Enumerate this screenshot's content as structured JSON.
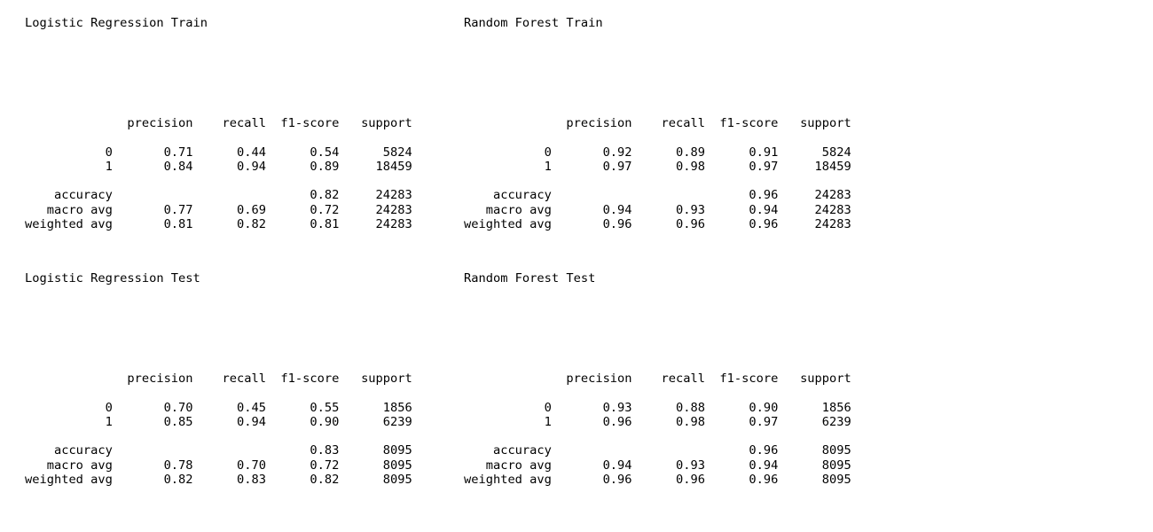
{
  "reports": [
    {
      "title": "Logistic Regression Train",
      "text": "\n\n\n\n\n\n              precision    recall  f1-score   support\n\n           0       0.71      0.44      0.54      5824\n           1       0.84      0.94      0.89     18459\n\n    accuracy                           0.82     24283\n   macro avg       0.77      0.69      0.72     24283\nweighted avg       0.81      0.82      0.81     24283"
    },
    {
      "title": "Random Forest Train",
      "text": "\n\n\n\n\n\n              precision    recall  f1-score   support\n\n           0       0.92      0.89      0.91      5824\n           1       0.97      0.98      0.97     18459\n\n    accuracy                           0.96     24283\n   macro avg       0.94      0.93      0.94     24283\nweighted avg       0.96      0.96      0.96     24283"
    },
    {
      "title": "Logistic Regression Test",
      "text": "\n\n\n\n\n\n              precision    recall  f1-score   support\n\n           0       0.70      0.45      0.55      1856\n           1       0.85      0.94      0.90      6239\n\n    accuracy                           0.83      8095\n   macro avg       0.78      0.70      0.72      8095\nweighted avg       0.82      0.83      0.82      8095"
    },
    {
      "title": "Random Forest Test",
      "text": "\n\n\n\n\n\n              precision    recall  f1-score   support\n\n           0       0.93      0.88      0.90      1856\n           1       0.96      0.98      0.97      6239\n\n    accuracy                           0.96      8095\n   macro avg       0.94      0.93      0.94      8095\nweighted avg       0.96      0.96      0.96      8095"
    }
  ]
}
